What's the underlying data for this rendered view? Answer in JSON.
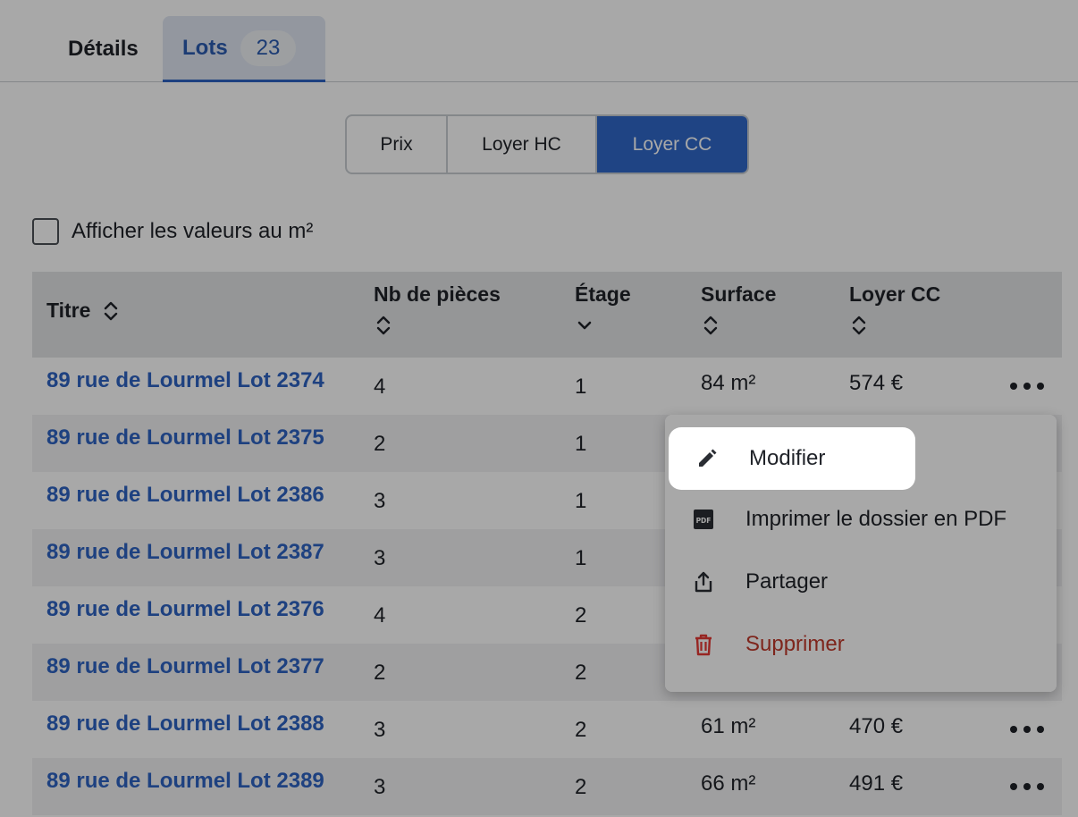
{
  "tabs": {
    "details_label": "Détails",
    "lots_label": "Lots",
    "lots_count": "23"
  },
  "price_toggle": {
    "options": [
      "Prix",
      "Loyer HC",
      "Loyer CC"
    ],
    "selected": "Loyer CC"
  },
  "checkbox": {
    "label": "Afficher les valeurs au m²",
    "checked": false
  },
  "table": {
    "headers": {
      "titre": "Titre",
      "pieces": "Nb de pièces",
      "etage": "Étage",
      "surface": "Surface",
      "loyer": "Loyer CC"
    },
    "rows": [
      {
        "titre": "89 rue de Lourmel Lot 2374",
        "pieces": "4",
        "etage": "1",
        "surface": "84 m²",
        "loyer": "574 €"
      },
      {
        "titre": "89 rue de Lourmel Lot 2375",
        "pieces": "2",
        "etage": "1",
        "surface": "",
        "loyer": ""
      },
      {
        "titre": "89 rue de Lourmel Lot 2386",
        "pieces": "3",
        "etage": "1",
        "surface": "",
        "loyer": ""
      },
      {
        "titre": "89 rue de Lourmel Lot 2387",
        "pieces": "3",
        "etage": "1",
        "surface": "",
        "loyer": ""
      },
      {
        "titre": "89 rue de Lourmel Lot 2376",
        "pieces": "4",
        "etage": "2",
        "surface": "",
        "loyer": ""
      },
      {
        "titre": "89 rue de Lourmel Lot 2377",
        "pieces": "2",
        "etage": "2",
        "surface": "",
        "loyer": ""
      },
      {
        "titre": "89 rue de Lourmel Lot 2388",
        "pieces": "3",
        "etage": "2",
        "surface": "61 m²",
        "loyer": "470 €"
      },
      {
        "titre": "89 rue de Lourmel Lot 2389",
        "pieces": "3",
        "etage": "2",
        "surface": "66 m²",
        "loyer": "491 €"
      }
    ]
  },
  "context_menu": {
    "items": [
      {
        "label": "Modifier",
        "icon": "pencil-icon"
      },
      {
        "label": "Imprimer le dossier en PDF",
        "icon": "pdf-icon"
      },
      {
        "label": "Partager",
        "icon": "share-icon"
      },
      {
        "label": "Supprimer",
        "icon": "trash-icon"
      }
    ]
  },
  "colors": {
    "link": "#2e63c2",
    "selected_segment": "#2f68c9",
    "danger": "#c0392b",
    "header_bg": "#e3e4e6"
  }
}
